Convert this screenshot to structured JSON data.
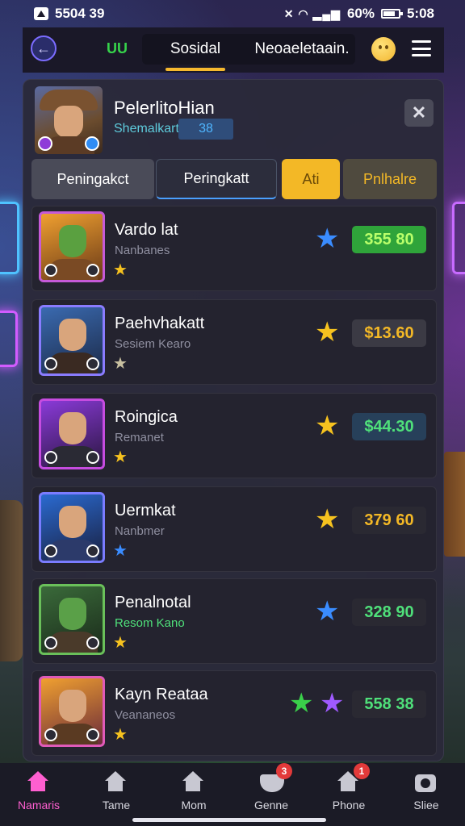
{
  "status_bar": {
    "time": "5504 39",
    "battery": "60%",
    "clock_right": "5:08"
  },
  "top_nav": {
    "uu_label": "UU",
    "tabs": [
      {
        "label": "Sosidal",
        "active": true
      },
      {
        "label": "Neoaeletaain.",
        "active": false
      }
    ]
  },
  "profile": {
    "name": "PelerlitoHian",
    "subtitle": "Shemalkart",
    "level": "38"
  },
  "filters": [
    {
      "label": "Peningakct"
    },
    {
      "label": "Peringkatt"
    },
    {
      "label": "Ati"
    },
    {
      "label": "Pnlhalre"
    }
  ],
  "rows": [
    {
      "name": "Vardo lat",
      "sub": "Nanbanes",
      "price": "355 80",
      "price_color": "#b9ff6a",
      "price_bg": "#2fa43a",
      "star": "blue",
      "small_star": "gold",
      "avatar_theme": "orc"
    },
    {
      "name": "Paehvhakatt",
      "sub": "Sesiem Kearo",
      "price": "$13.60",
      "price_color": "#f3b826",
      "price_bg": "#3b3a44",
      "star": "gold",
      "small_star": "silver",
      "avatar_theme": "horned-blue"
    },
    {
      "name": "Roingica",
      "sub": "Remanet",
      "price": "$44.30",
      "price_color": "#4fe07a",
      "price_bg": "#27405a",
      "star": "gold",
      "small_star": "gold",
      "avatar_theme": "horned-purple"
    },
    {
      "name": "Uermkat",
      "sub": "Nanbmer",
      "price": "379 60",
      "price_color": "#f3b826",
      "price_bg": "#2a2932",
      "star": "gold",
      "small_star": "blue",
      "avatar_theme": "horned-blue2"
    },
    {
      "name": "Penalnotal",
      "sub": "Resom Kano",
      "price": "328 90",
      "price_color": "#4fe07a",
      "price_bg": "#2a2932",
      "star": "blue",
      "small_star": "gold",
      "avatar_theme": "goblin"
    },
    {
      "name": "Kayn Reataa",
      "sub": "Veananeos",
      "price": "558 38",
      "price_color": "#4fe07a",
      "price_bg": "#2a2932",
      "star": "green-purple",
      "small_star": "gold",
      "avatar_theme": "horned-gold"
    }
  ],
  "bottom_nav": [
    {
      "label": "Namaris",
      "icon": "home-icon",
      "active": true,
      "badge": ""
    },
    {
      "label": "Tame",
      "icon": "building-icon",
      "active": false,
      "badge": ""
    },
    {
      "label": "Mom",
      "icon": "house-icon",
      "active": false,
      "badge": ""
    },
    {
      "label": "Genne",
      "icon": "bowl-icon",
      "active": false,
      "badge": "3"
    },
    {
      "label": "Phone",
      "icon": "house-alert-icon",
      "active": false,
      "badge": "1"
    },
    {
      "label": "Sliee",
      "icon": "camera-icon",
      "active": false,
      "badge": ""
    }
  ]
}
